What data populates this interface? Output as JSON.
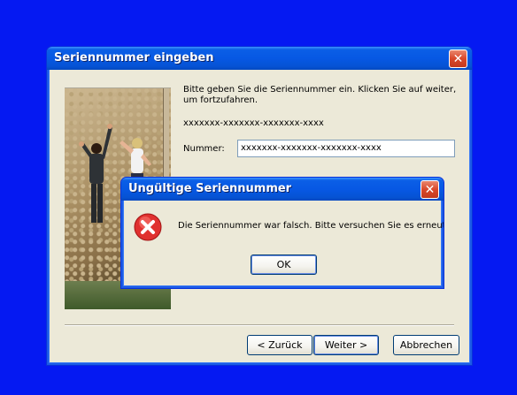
{
  "main_window": {
    "title": "Seriennummer eingeben",
    "instructions": "Bitte geben Sie die Seriennummer ein. Klicken Sie auf weiter, um fortzufahren.",
    "serial_example": "xxxxxxx-xxxxxxx-xxxxxxx-xxxx",
    "number_label": "Nummer:",
    "number_value": "xxxxxxx-xxxxxxx-xxxxxxx-xxxx",
    "buttons": {
      "back": "< Zurück",
      "next": "Weiter >",
      "cancel": "Abbrechen"
    }
  },
  "error_dialog": {
    "title": "Ungültige Seriennummer",
    "message": "Die Seriennummer war falsch. Bitte versuchen Sie es erneut.",
    "ok": "OK"
  },
  "icons": {
    "close": "close-icon",
    "error": "error-icon"
  },
  "colors": {
    "desktop": "#0519f2",
    "titlebar": "#0758e4",
    "window_face": "#ece9d8",
    "close_button": "#d9472a",
    "error_red": "#e0312f"
  }
}
